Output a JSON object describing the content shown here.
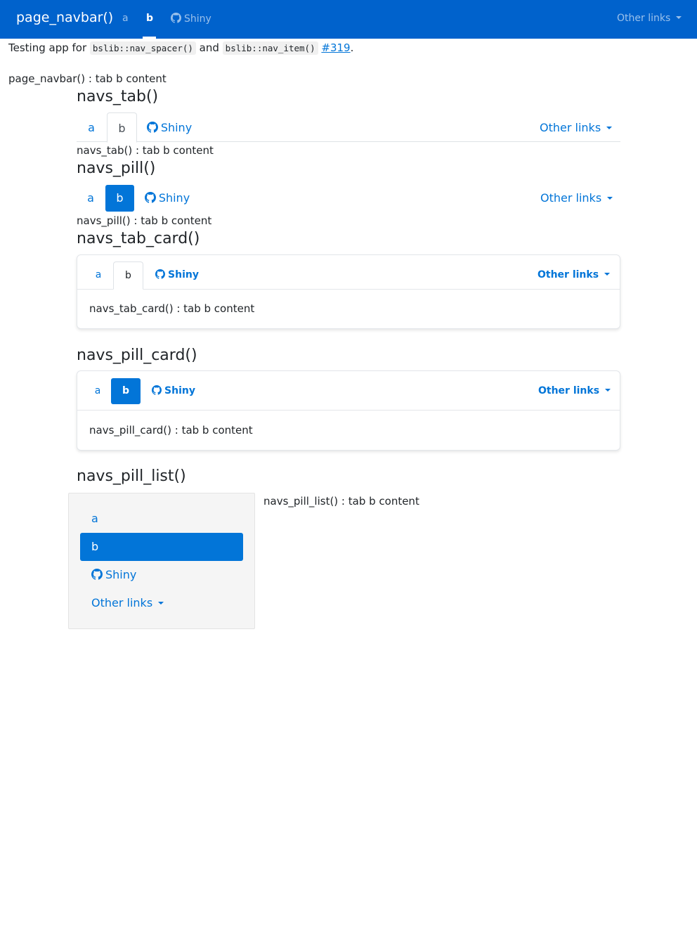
{
  "navbar": {
    "brand": "page_navbar()",
    "items": [
      "a",
      "b",
      "Shiny"
    ],
    "active": "b",
    "other_links": "Other links"
  },
  "intro": {
    "prefix": "Testing app for ",
    "code1": "bslib::nav_spacer()",
    "and": " and ",
    "code2": "bslib::nav_item()",
    "space": " ",
    "link": "#319",
    "suffix": "."
  },
  "navbar_content": "page_navbar() : tab b content",
  "navs_tab": {
    "title": "navs_tab()",
    "items": [
      "a",
      "b",
      "Shiny"
    ],
    "other_links": "Other links",
    "content": "navs_tab() : tab b content"
  },
  "navs_pill": {
    "title": "navs_pill()",
    "items": [
      "a",
      "b",
      "Shiny"
    ],
    "other_links": "Other links",
    "content": "navs_pill() : tab b content"
  },
  "navs_tab_card": {
    "title": "navs_tab_card()",
    "items": [
      "a",
      "b",
      "Shiny"
    ],
    "other_links": "Other links",
    "content": "navs_tab_card() : tab b content"
  },
  "navs_pill_card": {
    "title": "navs_pill_card()",
    "items": [
      "a",
      "b",
      "Shiny"
    ],
    "other_links": "Other links",
    "content": "navs_pill_card() : tab b content"
  },
  "navs_pill_list": {
    "title": "navs_pill_list()",
    "items": [
      "a",
      "b",
      "Shiny"
    ],
    "other_links": "Other links",
    "content": "navs_pill_list() : tab b content"
  },
  "colors": {
    "navbar_bg": "#0062cc",
    "accent": "#0275d8"
  },
  "icons": {
    "shiny": "github-icon",
    "dropdown": "caret-down-icon"
  }
}
